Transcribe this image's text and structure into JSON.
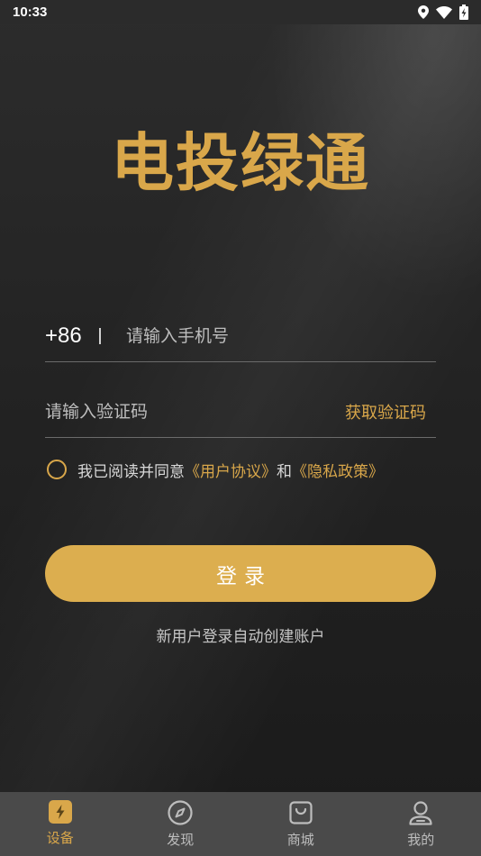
{
  "status_bar": {
    "time": "10:33",
    "icons": [
      "location-icon",
      "wifi-icon",
      "battery-icon"
    ]
  },
  "brand": {
    "title": "电投绿通"
  },
  "login_form": {
    "country_code": "+86",
    "phone_placeholder": "请输入手机号",
    "code_placeholder": "请输入验证码",
    "get_code_label": "获取验证码",
    "agreement": {
      "prefix": "我已阅读并同意",
      "user_agreement": "《用户协议》",
      "conjunction": "和",
      "privacy_policy": "《隐私政策》"
    },
    "login_label": "登录",
    "hint": "新用户登录自动创建账户"
  },
  "tabbar": {
    "items": [
      {
        "label": "设备",
        "icon": "device-icon",
        "active": true
      },
      {
        "label": "发现",
        "icon": "compass-icon",
        "active": false
      },
      {
        "label": "商城",
        "icon": "shopping-bag-icon",
        "active": false
      },
      {
        "label": "我的",
        "icon": "user-icon",
        "active": false
      }
    ]
  },
  "colors": {
    "accent": "#d9a74a",
    "button": "#dcae4f",
    "tab_inactive": "#bdbdbd",
    "tab_bg": "#4a4a4a"
  }
}
